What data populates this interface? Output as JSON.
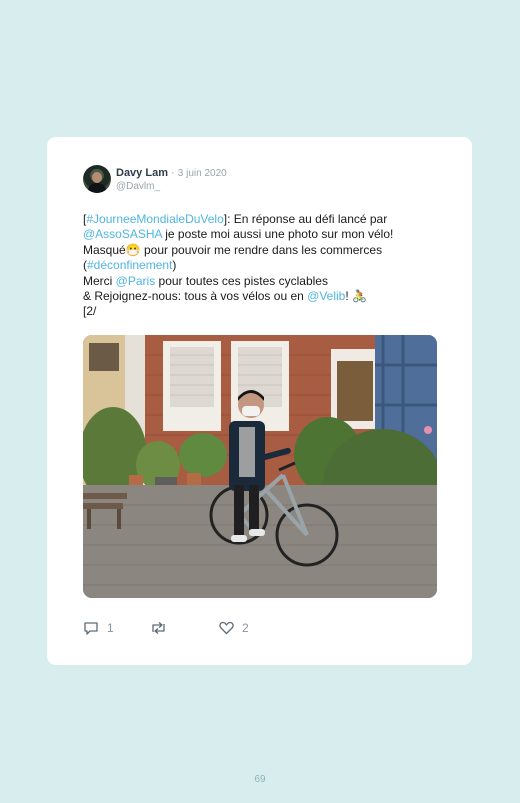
{
  "tweet": {
    "author_name": "Davy Lam",
    "separator": "·",
    "date": "3 juin 2020",
    "handle": "@Davlm_",
    "lines": [
      [
        {
          "text": "[",
          "link": false
        },
        {
          "text": "#JourneeMondialeDuVelo",
          "link": true
        },
        {
          "text": "]: En réponse au défi lancé par",
          "link": false
        }
      ],
      [
        {
          "text": "@AssoSASHA",
          "link": true
        },
        {
          "text": " je poste moi aussi une photo sur mon vélo!",
          "link": false
        }
      ],
      [
        {
          "text": "Masqué",
          "link": false
        },
        {
          "text": "😷",
          "link": false
        },
        {
          "text": " pour pouvoir me rendre dans les commerces",
          "link": false
        }
      ],
      [
        {
          "text": "(",
          "link": false
        },
        {
          "text": "#déconfinement",
          "link": true
        },
        {
          "text": ")",
          "link": false
        }
      ],
      [
        {
          "text": "Merci ",
          "link": false
        },
        {
          "text": "@Paris",
          "link": true
        },
        {
          "text": " pour toutes ces pistes cyclables",
          "link": false
        }
      ],
      [
        {
          "text": "& Rejoignez-nous: tous à vos vélos ou en ",
          "link": false
        },
        {
          "text": "@Velib",
          "link": true
        },
        {
          "text": "! 🚴",
          "link": false
        }
      ],
      [
        {
          "text": "[2/",
          "link": false
        }
      ]
    ],
    "reply_count": "1",
    "like_count": "2",
    "icons": {
      "reply": "reply-icon",
      "retweet": "retweet-icon",
      "like": "like-icon"
    }
  },
  "colors": {
    "background": "#d8eeee",
    "link": "#4fb5e0"
  },
  "page_number": "69"
}
